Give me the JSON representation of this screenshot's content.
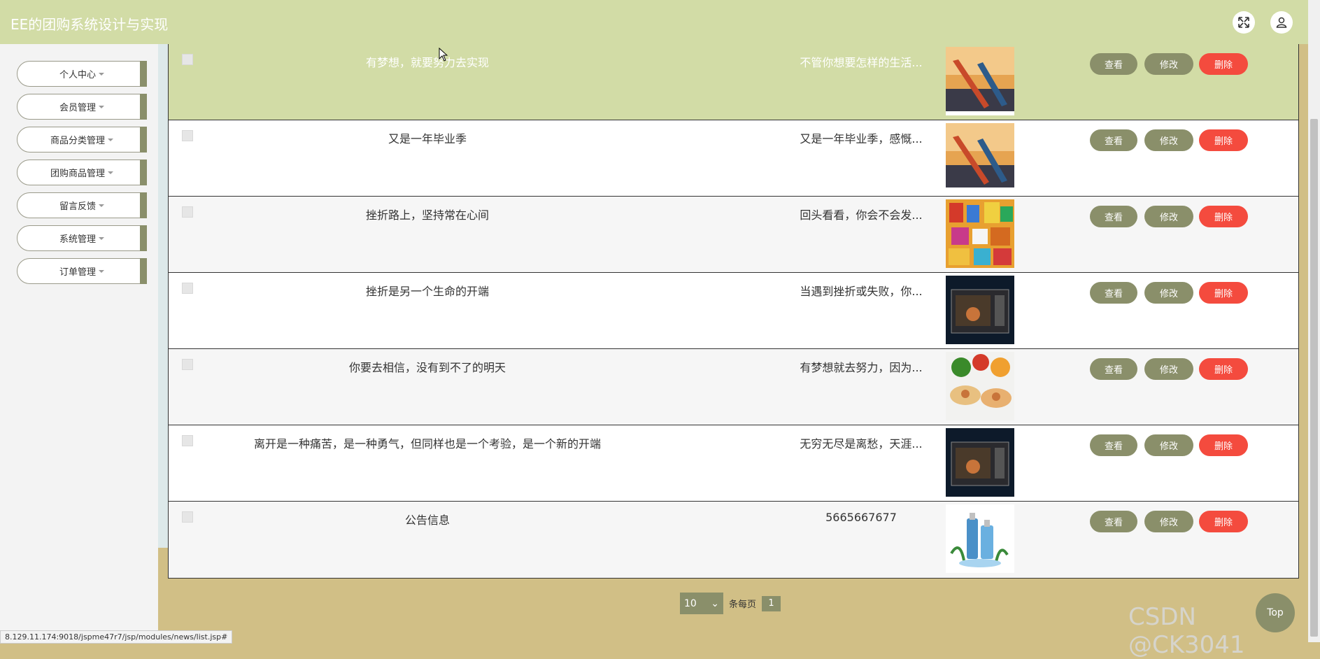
{
  "app": {
    "title": "EE的团购系统设计与实现"
  },
  "header": {
    "fullscreen_icon": "expand-icon",
    "user_icon": "user-icon"
  },
  "sidebar": {
    "items": [
      {
        "label": "个人中心"
      },
      {
        "label": "会员管理"
      },
      {
        "label": "商品分类管理"
      },
      {
        "label": "团购商品管理"
      },
      {
        "label": "留言反馈"
      },
      {
        "label": "系统管理"
      },
      {
        "label": "订单管理"
      }
    ]
  },
  "table": {
    "rows": [
      {
        "title": "有梦想，就要努力去实现",
        "intro": "不管你想要怎样的生活...",
        "image": "kayak-photo",
        "highlighted": true
      },
      {
        "title": "又是一年毕业季",
        "intro": "又是一年毕业季，感慨...",
        "image": "kayak-photo"
      },
      {
        "title": "挫折路上，坚持常在心间",
        "intro": "回头看看，你会不会发...",
        "image": "snacks-photo"
      },
      {
        "title": "挫折是另一个生命的开端",
        "intro": "当遇到挫折或失败，你...",
        "image": "microwave-photo"
      },
      {
        "title": "你要去相信，没有到不了的明天",
        "intro": "有梦想就去努力，因为...",
        "image": "food-photo"
      },
      {
        "title": "离开是一种痛苦，是一种勇气，但同样也是一个考验，是一个新的开端",
        "intro": "无穷无尽是离愁，天涯...",
        "image": "microwave-photo"
      },
      {
        "title": "公告信息",
        "intro": "5665667677",
        "image": "cosmetics-photo"
      }
    ],
    "actions": {
      "view": "查看",
      "edit": "修改",
      "delete": "删除"
    }
  },
  "pager": {
    "page_size": "10",
    "per_page_label": "条每页",
    "current_page": "1"
  },
  "status_bar": {
    "url": "8.129.11.174:9018/jspme47r7/jsp/modules/news/list.jsp#"
  },
  "back_to_top": {
    "label": "Top"
  },
  "watermark": {
    "text": "CSDN @CK3041"
  },
  "colors": {
    "topbar": "#d2dca6",
    "accent": "#8a8f6a",
    "danger": "#f44b3e",
    "background": "#d1bf86"
  }
}
